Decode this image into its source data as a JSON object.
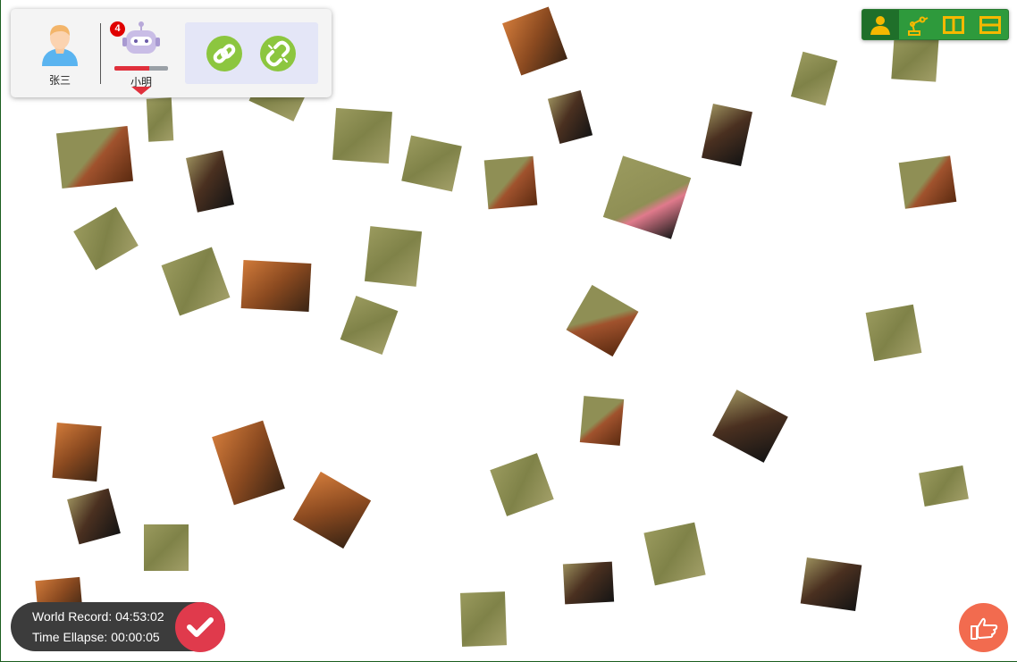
{
  "players": [
    {
      "name": "张三",
      "icon": "user-avatar-icon"
    },
    {
      "name": "小明",
      "icon": "robot-avatar-icon",
      "badge": "4",
      "progress": 0.65
    }
  ],
  "actions": [
    {
      "icon": "link-icon"
    },
    {
      "icon": "unlink-icon"
    }
  ],
  "toolbar": [
    {
      "icon": "person-icon",
      "active": true
    },
    {
      "icon": "robot-arm-icon",
      "active": false
    },
    {
      "icon": "split-vertical-icon",
      "active": false
    },
    {
      "icon": "split-horizontal-icon",
      "active": false
    }
  ],
  "timer": {
    "world_record_label": "World Record:",
    "world_record": "04:53:02",
    "elapsed_label": "Time Ellapse:",
    "elapsed": "00:00:05"
  },
  "colors": {
    "grass": "#8a8a55",
    "panel": "#f4f4f4",
    "toolbar": "#2e9a3c",
    "accent_red": "#e03a4c",
    "hint": "#f26b4f",
    "link_green": "#8cc63f"
  }
}
